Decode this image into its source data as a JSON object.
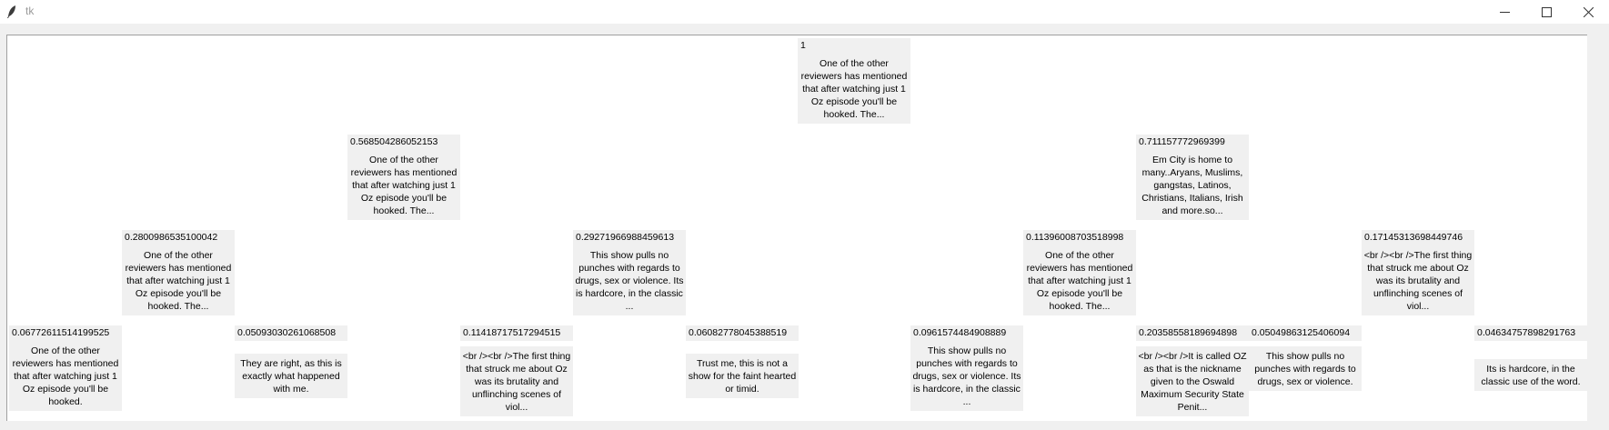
{
  "window": {
    "title": "tk",
    "app_icon": "feather-icon"
  },
  "controls": {
    "minimize": "minimize-icon",
    "maximize": "maximize-icon",
    "close": "close-icon"
  },
  "nodes": [
    {
      "score": "1",
      "text": "One of the other reviewers has mentioned that after watching just 1 Oz episode you'll be hooked. The..."
    },
    {
      "score": "0.568504286052153",
      "text": "One of the other reviewers has mentioned that after watching just 1 Oz episode you'll be hooked. The..."
    },
    {
      "score": "0.711157772969399",
      "text": "Em City is home to many..Aryans, Muslims, gangstas, Latinos, Christians, Italians, Irish and more.so..."
    },
    {
      "score": "0.2800986535100042",
      "text": "One of the other reviewers has mentioned that after watching just 1 Oz episode you'll be hooked. The..."
    },
    {
      "score": "0.29271966988459613",
      "text": "This show pulls no punches with regards to drugs, sex or violence. Its is hardcore, in the classic ..."
    },
    {
      "score": "0.11396008703518998",
      "text": "One of the other reviewers has mentioned that after watching just 1 Oz episode you'll be hooked. The..."
    },
    {
      "score": "0.17145313698449746",
      "text": "<br /><br />The first thing that struck me about Oz was its brutality and unflinching scenes of viol..."
    },
    {
      "score": "0.06772611514199525",
      "text": "One of the other reviewers has mentioned that after watching just 1 Oz episode you'll be hooked."
    },
    {
      "score": "0.05093030261068508",
      "text": "They are right, as this is exactly what happened with me."
    },
    {
      "score": "0.11418717517294515",
      "text": "<br /><br />The first thing that struck me about Oz was its brutality and unflinching scenes of viol..."
    },
    {
      "score": "0.06082778045388519",
      "text": "Trust me, this is not a show for the faint hearted or timid."
    },
    {
      "score": "0.0961574484908889",
      "text": "This show pulls no punches with regards to drugs, sex or violence. Its is hardcore, in the classic ..."
    },
    {
      "score": "0.20358558189694898",
      "text": "<br /><br />It is called OZ as that is the nickname given to the Oswald Maximum Security State Penit..."
    },
    {
      "score": "0.05049863125406094",
      "text": "This show pulls no punches with regards to drugs, sex or violence."
    },
    {
      "score": "0.04634757898291763",
      "text": "Its is hardcore, in the classic use of the word."
    }
  ]
}
